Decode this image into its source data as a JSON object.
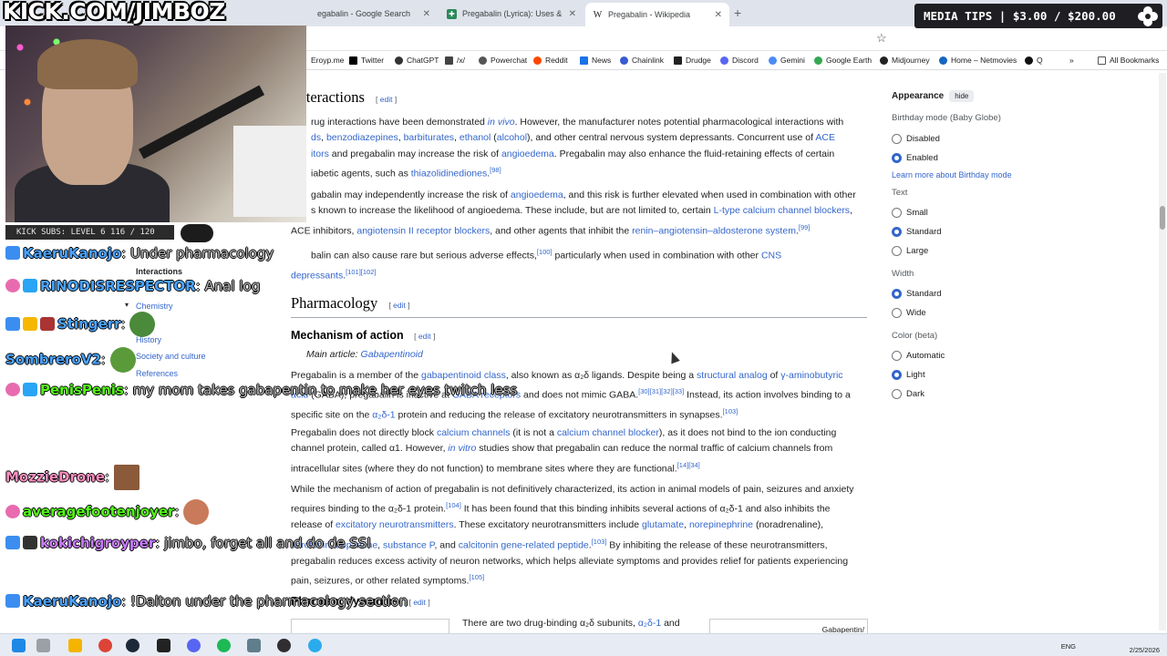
{
  "browser": {
    "tabs": [
      {
        "label": "egabalin - Google Search",
        "icon": "google-icon"
      },
      {
        "label": "Pregabalin (Lyrica): Uses & Side",
        "icon": "drugs-icon"
      },
      {
        "label": "Pregabalin - Wikipedia",
        "icon": "wikipedia-icon",
        "active": true
      }
    ],
    "bookmarks": [
      "Eroyp.me",
      "Twitter",
      "ChatGPT",
      "/x/",
      "Powerchat",
      "Reddit",
      "News",
      "Chainlink",
      "Drudge",
      "Discord",
      "Gemini",
      "Google Earth",
      "Midjourney",
      "Home – Netmovies",
      "Q",
      "All Bookmarks"
    ]
  },
  "overlay": {
    "site": "KICK.COM/JIMBOZ",
    "subs": "KICK SUBS: LEVEL 6 116 / 120",
    "media_tips": "MEDIA TIPS | $3.00 / $200.00",
    "chat": [
      {
        "user": "KaeruKanojo",
        "message": "Under pharmacology"
      },
      {
        "user": "RINODISRESPECTOR",
        "message": "Anal log"
      },
      {
        "user": "Stingerr",
        "message": ""
      },
      {
        "user": "SombreroV2",
        "message": ""
      },
      {
        "user": "PenisPenis",
        "message": "my mom takes gabapentin to make her eyes twitch less"
      },
      {
        "user": "MozzieDrone",
        "message": ""
      },
      {
        "user": "averagefootenjoyer",
        "message": ""
      },
      {
        "user": "kokichigroyper",
        "message": "jimbo, forget all and do de SSI"
      },
      {
        "user": "KaeruKanojo",
        "message": "!Dalton under the pharmacology section"
      }
    ]
  },
  "toc": {
    "items": [
      "Interactions",
      "Chemistry",
      "History",
      "Society and culture",
      "References"
    ]
  },
  "article": {
    "interactions_heading": "Interactions",
    "edit": "edit",
    "p1": {
      "t1": "rug interactions have been demonstrated ",
      "l1": "in vivo",
      "t2": ". However, the manufacturer notes potential pharmacological interactions with",
      "l2": "ds",
      "t3": ", ",
      "l3": "benzodiazepines",
      "t4": ", ",
      "l4": "barbiturates",
      "t5": ", ",
      "l5": "ethanol",
      "t6": " (",
      "l6": "alcohol",
      "t7": "), and other central nervous system depressants. Concurrent use of ",
      "l7": "ACE",
      "l8": "itors",
      "t8": " and pregabalin may increase the risk of ",
      "l9": "angioedema",
      "t9": ". Pregabalin may also enhance the fluid-retaining effects of certain",
      "t10": "iabetic agents, such as ",
      "l10": "thiazolidinediones",
      "t11": ".",
      "s1": "[98]"
    },
    "p2": {
      "t1": "gabalin may independently increase the risk of ",
      "l1": "angioedema",
      "t2": ", and this risk is further elevated when used in combination with other",
      "t3": "s known to increase the likelihood of angioedema. These include, but are not limited to, certain ",
      "l2": "L-type calcium channel blockers",
      "t4": ",",
      "t5": "ACE inhibitors, ",
      "l3": "angiotensin II receptor blockers",
      "t6": ", and other agents that inhibit the ",
      "l4": "renin–angiotensin–aldosterone system",
      "t7": ".",
      "s1": "[99]"
    },
    "p3": {
      "t1": "balin can also cause rare but serious adverse effects,",
      "s1": "[100]",
      "t2": " particularly when used in combination with other ",
      "l1": "CNS",
      "l2": "depressants",
      "t3": ".",
      "s2": "[101][102]"
    },
    "pharmacology_heading": "Pharmacology",
    "moa_heading": "Mechanism of action",
    "main_article_label": "Main article: ",
    "main_article_link": "Gabapentinoid",
    "p4": {
      "t1": "Pregabalin is a member of the ",
      "l1": "gabapentinoid class",
      "t2": ", also known as α₂δ ligands. Despite being a ",
      "l2": "structural analog",
      "t3": " of ",
      "l3": "γ-aminobutyric",
      "l4": "acid",
      "t4": " (GABA), pregabalin is inactive at ",
      "l5": "GABA receptors",
      "t5": " and does not mimic GABA.",
      "s1": "[30][31][32][33]",
      "t6": " Instead, its action involves binding to a",
      "t7": "specific site on the ",
      "l6": "α₂δ-1",
      "t8": " protein and reducing the release of excitatory neurotransmitters in synapses.",
      "s2": "[103]"
    },
    "p5": {
      "t1": "Pregabalin does not directly block ",
      "l1": "calcium channels",
      "t2": " (it is not a ",
      "l2": "calcium channel blocker",
      "t3": "), as it does not bind to the ion conducting",
      "t4": "channel protein, called α1. However, ",
      "l3": "in vitro",
      "t5": " studies show that pregabalin can reduce the normal traffic of calcium channels from",
      "t6": "intracellular sites (where they do not function) to membrane sites where they are functional.",
      "s1": "[14][34]"
    },
    "p6": {
      "t1": "While the mechanism of action of pregabalin is not definitively characterized, its action in animal models of pain, seizures and anxiety",
      "t2": "requires binding to the α₂δ-1 protein.",
      "s1": "[104]",
      "t3": " It has been found that this binding inhibits several actions of α₂δ-1 and also inhibits the",
      "t4": "release of ",
      "l1": "excitatory neurotransmitters",
      "t5": ". These excitatory neurotransmitters include ",
      "l2": "glutamate",
      "t6": ", ",
      "l3": "norepinephrine",
      "t7": " (noradrenaline),",
      "l4": "serotonin",
      "t8": ", ",
      "l5": "dopamine",
      "t9": ", ",
      "l6": "substance P",
      "t10": ", and ",
      "l7": "calcitonin gene-related peptide",
      "t11": ".",
      "s2": "[103]",
      "t12": " By inhibiting the release of these neurotransmitters,",
      "t13": "pregabalin reduces excess activity of neuron networks, which helps alleviate symptoms and provides relief for patients experiencing",
      "t14": "pain, seizures, or other related symptoms.",
      "s3": "[105]"
    },
    "pharmacodynamics_heading": "Pharmacodynamics",
    "p7": {
      "t1": "There are two drug-binding α₂δ subunits, ",
      "l1": "α₂δ-1",
      "t2": " and"
    },
    "image_caption_right": "Gabapentin/"
  },
  "appearance": {
    "title": "Appearance",
    "hide": "hide",
    "birthday_label": "Birthday mode (Baby Globe)",
    "birthday_options": [
      "Disabled",
      "Enabled"
    ],
    "birthday_selected": "Enabled",
    "birthday_link": "Learn more about Birthday mode",
    "text_label": "Text",
    "text_options": [
      "Small",
      "Standard",
      "Large"
    ],
    "text_selected": "Standard",
    "width_label": "Width",
    "width_options": [
      "Standard",
      "Wide"
    ],
    "width_selected": "Standard",
    "color_label": "Color (beta)",
    "color_options": [
      "Automatic",
      "Light",
      "Dark"
    ],
    "color_selected": "Light"
  },
  "taskbar": {
    "lang": "ENG",
    "date": "2/25/2026"
  },
  "colors": {
    "link": "#3366cc",
    "accent": "#3366cc",
    "chat_name": "#4aa3ff",
    "chat_name_alt": "#53fc18"
  }
}
